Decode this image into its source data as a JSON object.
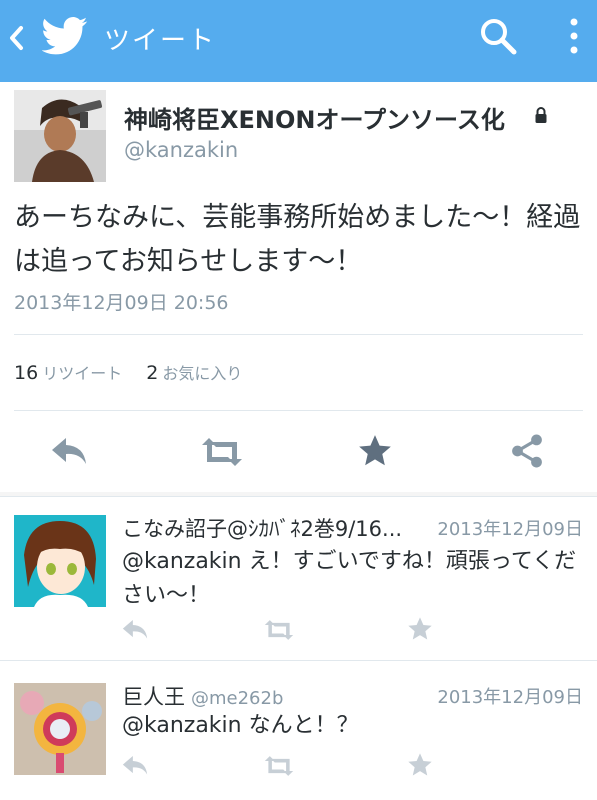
{
  "appbar": {
    "title": "ツイート",
    "back_icon": "chevron-left-icon",
    "logo_icon": "twitter-bird-icon",
    "search_icon": "search-icon",
    "menu_icon": "more-vertical-icon",
    "bg_color": "#55acee"
  },
  "tweet": {
    "author_name": "神崎将臣XENONオープンソース化",
    "protected_icon": "lock-icon",
    "handle": "@kanzakin",
    "text": "あーちなみに、芸能事務所始めました〜！経過は追ってお知らせします〜！",
    "timestamp": "2013年12月09日 20:56",
    "stats": {
      "retweets": "16",
      "retweets_label": "リツイート",
      "favorites": "2",
      "favorites_label": "お気に入り"
    },
    "actions": [
      "reply-icon",
      "retweet-icon",
      "favorite-star-icon",
      "share-icon"
    ]
  },
  "replies": [
    {
      "name": "こなみ詔子@ｼｶﾊﾞﾈ2巻9/16...",
      "handle": "",
      "date": "2013年12月09日",
      "text": "@kanzakin え！すごいですね！頑張ってください〜！"
    },
    {
      "name": "巨人王",
      "handle": "@me262b",
      "date": "2013年12月09日",
      "text": "@kanzakin なんと！？"
    }
  ],
  "colors": {
    "accent": "#55acee",
    "icon_gray": "#8899a6",
    "divider": "#e1e8ed"
  }
}
